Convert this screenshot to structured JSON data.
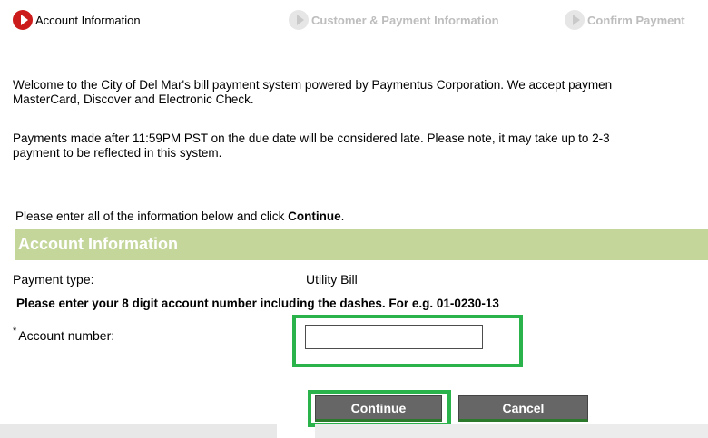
{
  "steps": [
    {
      "label": "Account Information",
      "state": "active",
      "icon": "play-circle-icon"
    },
    {
      "label": "Customer & Payment Information",
      "state": "inactive",
      "icon": "play-circle-icon"
    },
    {
      "label": "Confirm Payment",
      "state": "inactive",
      "icon": "play-circle-icon"
    }
  ],
  "intro": {
    "welcome_line1": "Welcome to the City of Del Mar's bill payment system powered by Paymentus Corporation. We accept paymen",
    "welcome_line2": "MasterCard, Discover and Electronic Check.",
    "late_line1": "Payments made after 11:59PM PST on the due date will be considered late. Please note, it may take up to 2-3",
    "late_line2": "payment to be reflected in this system."
  },
  "instruction": {
    "prefix": "Please enter all of the information below and click ",
    "bold": "Continue",
    "suffix": "."
  },
  "section": {
    "title": "Account Information"
  },
  "form": {
    "payment_type_label": "Payment type:",
    "payment_type_value": "Utility Bill",
    "hint": "Please enter your 8 digit account number including the dashes. For e.g. 01-0230-13",
    "required_mark": "*",
    "account_label": "Account number:",
    "account_value": ""
  },
  "buttons": {
    "continue": "Continue",
    "cancel": "Cancel"
  },
  "colors": {
    "active_step": "#cc1b1b",
    "section_header_bg": "#c5d69b",
    "highlight": "#2bb34b",
    "button_bg": "#666666"
  }
}
